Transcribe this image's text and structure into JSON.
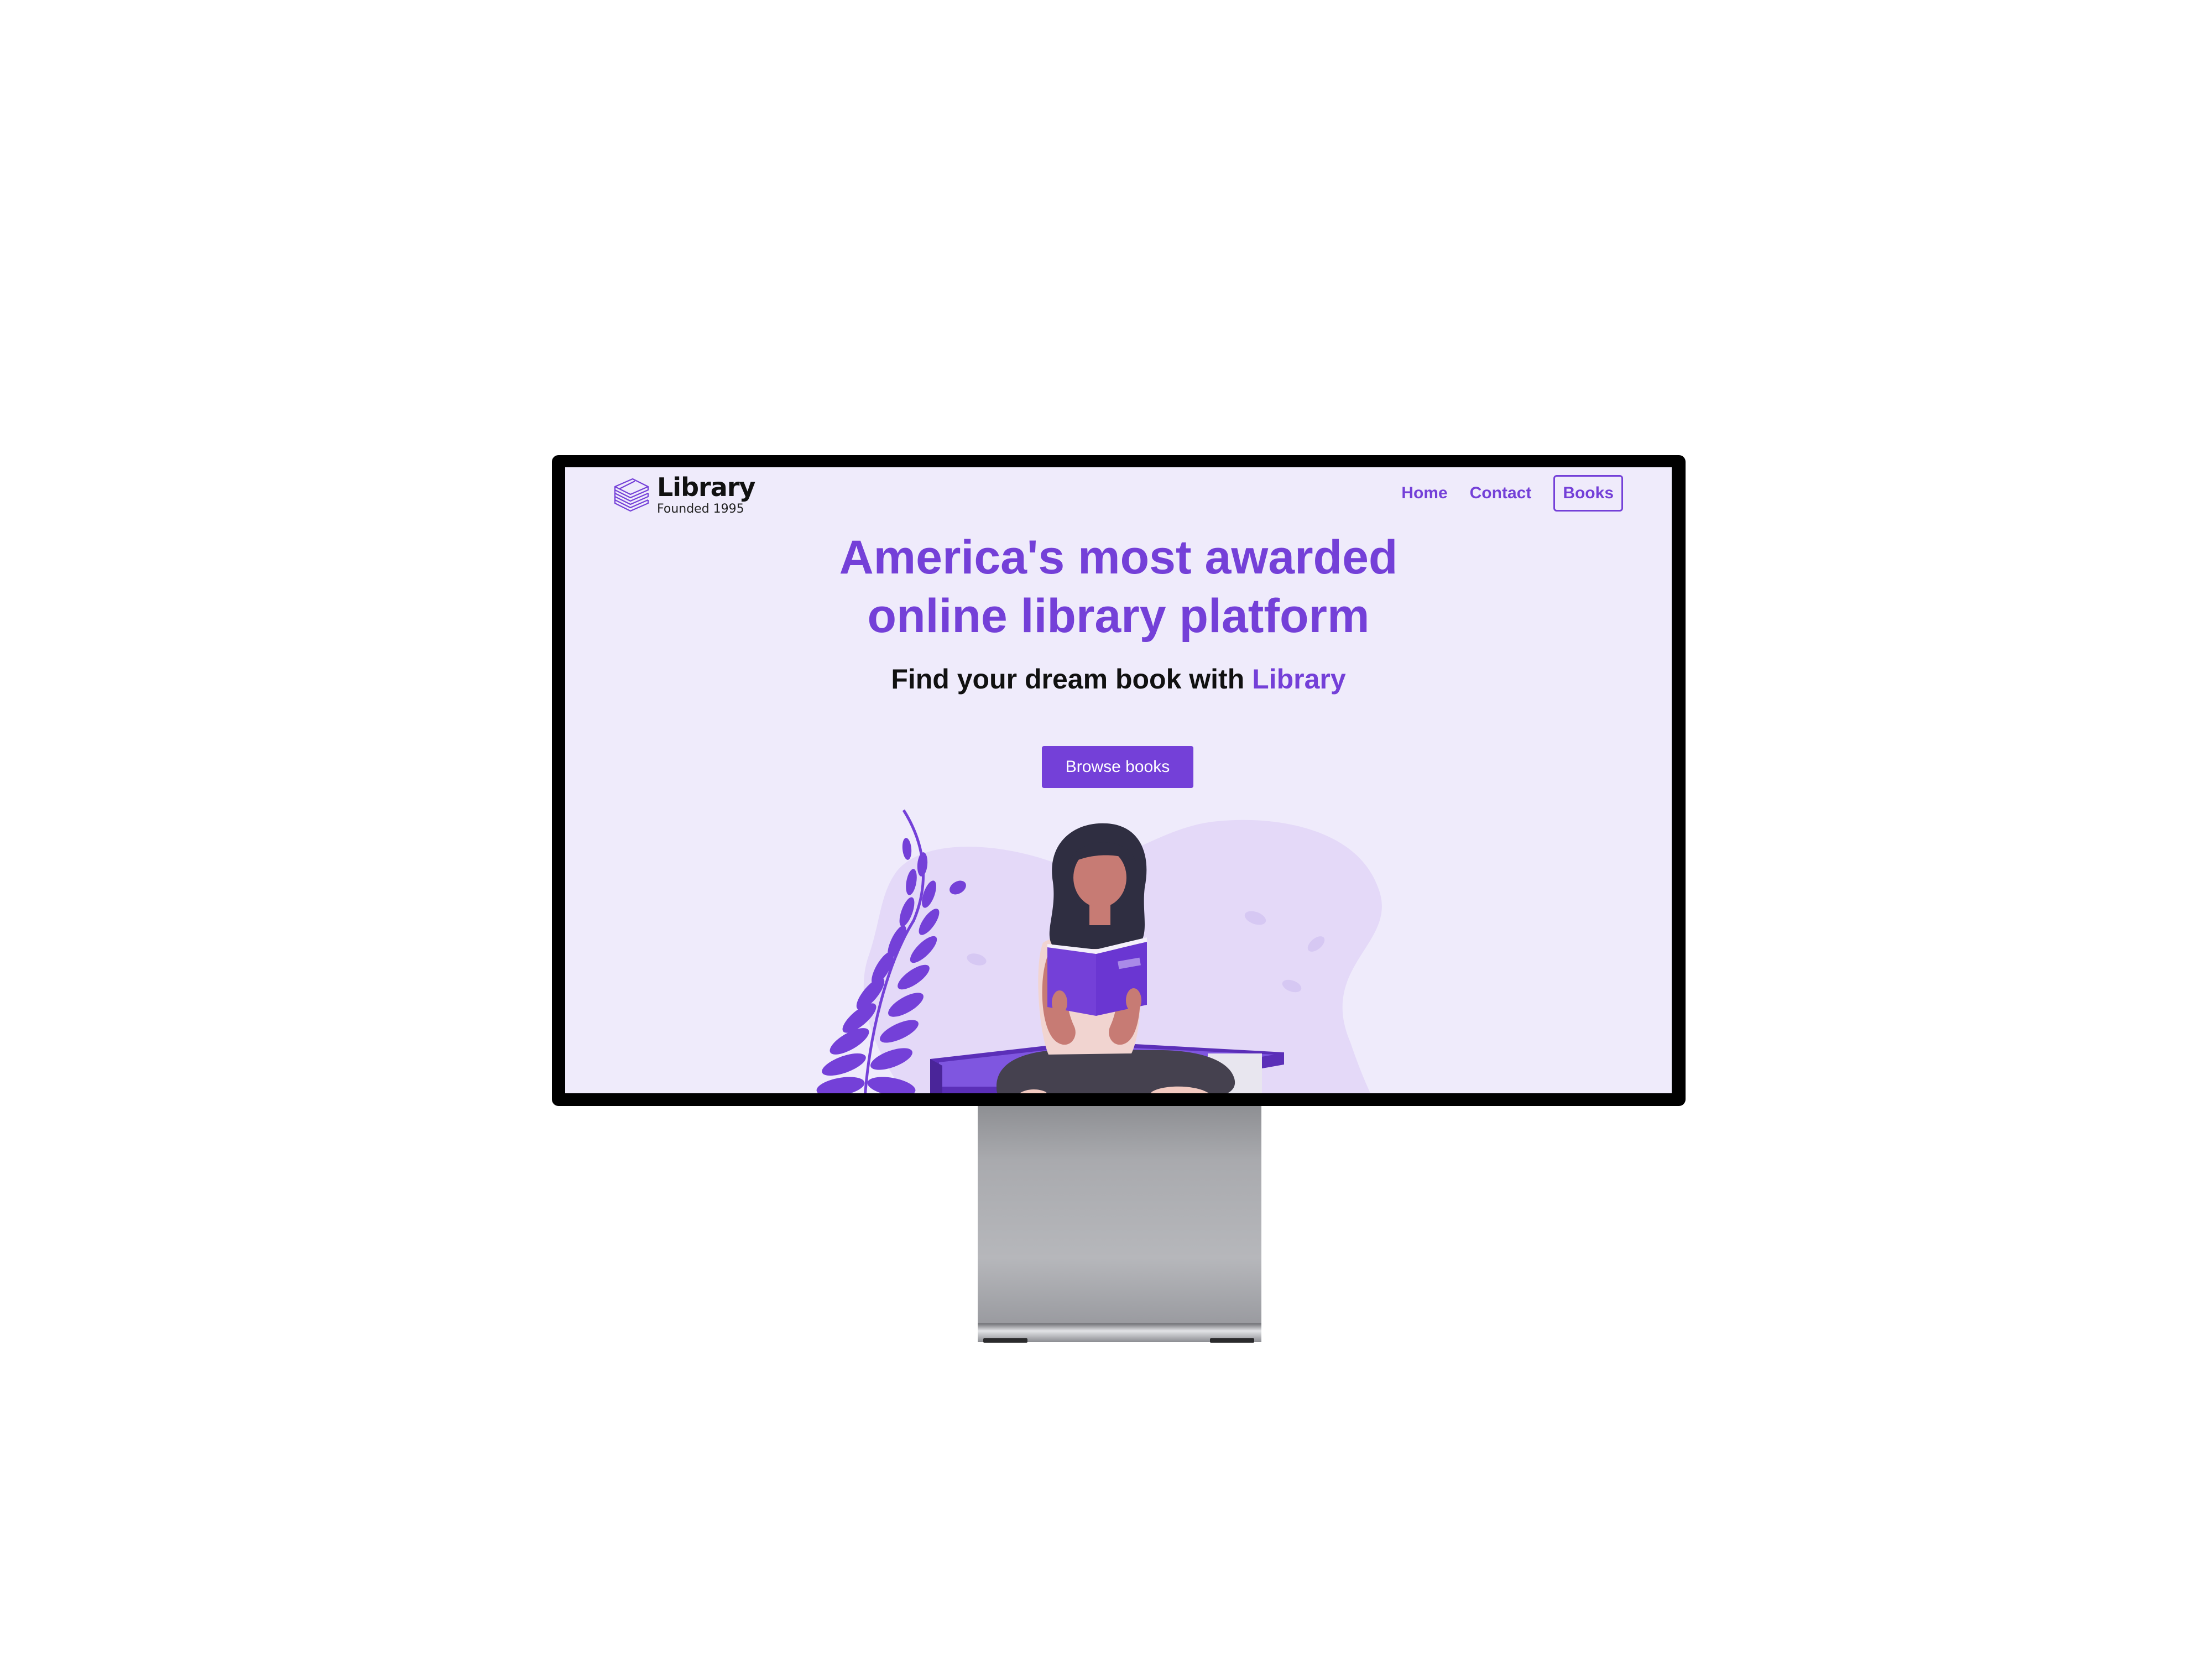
{
  "brand": {
    "name": "Library",
    "tagline": "Founded 1995"
  },
  "nav": {
    "items": [
      {
        "label": "Home"
      },
      {
        "label": "Contact"
      },
      {
        "label": "Books"
      }
    ]
  },
  "hero": {
    "title_line1": "America's most awarded",
    "title_line2": "online library platform",
    "subtitle_prefix": "Find your dream book with ",
    "subtitle_accent": "Library",
    "cta_label": "Browse books"
  },
  "colors": {
    "accent": "#7440d8",
    "screen_background": "#efebfb",
    "text_dark": "#111111"
  },
  "icons": {
    "logo": "stacked-books-icon"
  }
}
